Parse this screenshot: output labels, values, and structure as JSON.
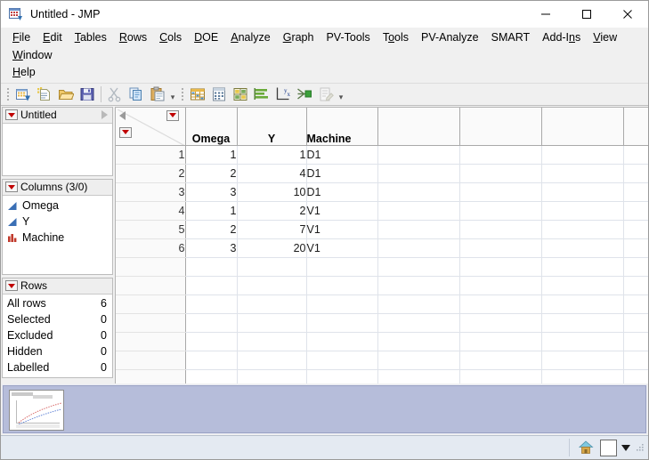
{
  "window": {
    "title": "Untitled - JMP",
    "app_icon": "jmp-table-icon",
    "minimize": "—",
    "maximize": "□",
    "close": "✕"
  },
  "menubar": {
    "items": [
      {
        "label": "File",
        "accel": "F"
      },
      {
        "label": "Edit",
        "accel": "E"
      },
      {
        "label": "Tables",
        "accel": "T"
      },
      {
        "label": "Rows",
        "accel": "R"
      },
      {
        "label": "Cols",
        "accel": "C"
      },
      {
        "label": "DOE",
        "accel": "D"
      },
      {
        "label": "Analyze",
        "accel": "A"
      },
      {
        "label": "Graph",
        "accel": "G"
      },
      {
        "label": "PV-Tools",
        "accel": ""
      },
      {
        "label": "Tools",
        "accel": "o"
      },
      {
        "label": "PV-Analyze",
        "accel": ""
      },
      {
        "label": "SMART",
        "accel": ""
      },
      {
        "label": "Add-Ins",
        "accel": "n"
      },
      {
        "label": "View",
        "accel": "V"
      },
      {
        "label": "Window",
        "accel": "W"
      }
    ],
    "second_row": [
      {
        "label": "Help",
        "accel": "H"
      }
    ]
  },
  "toolbar": {
    "group1": [
      {
        "name": "new-data-table-icon",
        "tip": "New Data Table"
      },
      {
        "name": "new-script-icon",
        "tip": "New Script"
      },
      {
        "name": "open-folder-icon",
        "tip": "Open Data Table"
      },
      {
        "name": "save-icon",
        "tip": "Save"
      }
    ],
    "group1b": [
      {
        "name": "cut-scissors-icon",
        "tip": "Cut",
        "disabled": true
      },
      {
        "name": "copy-icon",
        "tip": "Copy"
      },
      {
        "name": "paste-icon",
        "tip": "Paste"
      }
    ],
    "group2": [
      {
        "name": "data-table-icon",
        "tip": "Data Table"
      },
      {
        "name": "summary-icon",
        "tip": "Summary"
      },
      {
        "name": "tabulate-icon",
        "tip": "Tabulate"
      },
      {
        "name": "distribution-icon",
        "tip": "Distribution"
      },
      {
        "name": "fit-y-by-x-icon",
        "tip": "Fit Y by X"
      },
      {
        "name": "fit-model-icon",
        "tip": "Fit Model"
      },
      {
        "name": "edit-script-icon",
        "tip": "Script",
        "disabled": true
      }
    ],
    "overflow": "▾"
  },
  "sidebar": {
    "source_panel": {
      "title": "Untitled",
      "disclosure": "red-triangle",
      "expander": "grey-triangle"
    },
    "columns_panel": {
      "title": "Columns (3/0)",
      "items": [
        {
          "label": "Omega",
          "modeling_type": "continuous",
          "icon": "continuous-blue-triangle-icon"
        },
        {
          "label": "Y",
          "modeling_type": "continuous",
          "icon": "continuous-blue-triangle-icon"
        },
        {
          "label": "Machine",
          "modeling_type": "nominal",
          "icon": "nominal-red-bars-icon"
        }
      ]
    },
    "rows_panel": {
      "title": "Rows",
      "stats": [
        {
          "label": "All rows",
          "value": "6"
        },
        {
          "label": "Selected",
          "value": "0"
        },
        {
          "label": "Excluded",
          "value": "0"
        },
        {
          "label": "Hidden",
          "value": "0"
        },
        {
          "label": "Labelled",
          "value": "0"
        }
      ]
    }
  },
  "grid": {
    "columns": [
      "Omega",
      "Y",
      "Machine"
    ],
    "rows": [
      {
        "n": "1",
        "Omega": "1",
        "Y": "1",
        "Machine": "D1"
      },
      {
        "n": "2",
        "Omega": "2",
        "Y": "4",
        "Machine": "D1"
      },
      {
        "n": "3",
        "Omega": "3",
        "Y": "10",
        "Machine": "D1"
      },
      {
        "n": "4",
        "Omega": "1",
        "Y": "2",
        "Machine": "V1"
      },
      {
        "n": "5",
        "Omega": "2",
        "Y": "7",
        "Machine": "V1"
      },
      {
        "n": "6",
        "Omega": "3",
        "Y": "20",
        "Machine": "V1"
      }
    ],
    "empty_columns": 3,
    "empty_rows": 8
  },
  "dock": {
    "thumbnail": {
      "name": "report-window-thumbnail",
      "content": "line-plot-red-blue"
    }
  },
  "statusbar": {
    "home_icon": "home-icon",
    "box_button": "white-square-button",
    "caret": "▼"
  },
  "colors": {
    "accent_red": "#c00000",
    "continuous_blue": "#3a6fb5",
    "dock_lavender": "#b6bdda",
    "status_bg": "#e4eaf2"
  }
}
